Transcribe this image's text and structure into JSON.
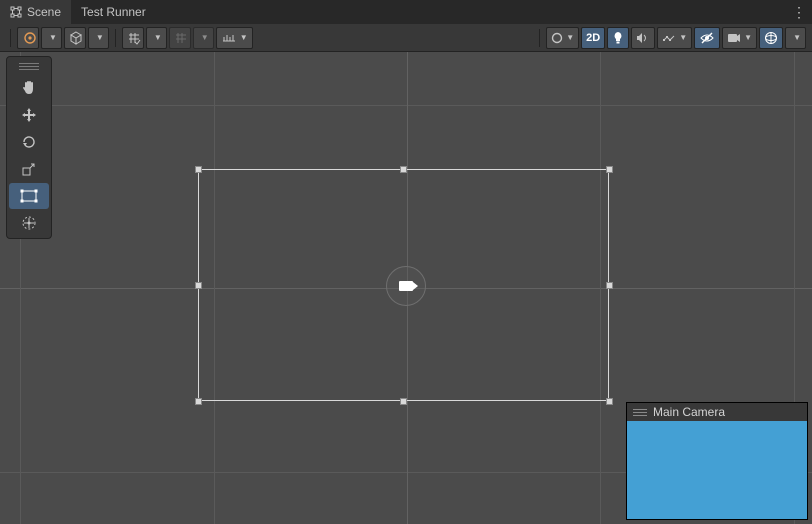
{
  "tabs": {
    "scene": "Scene",
    "test_runner": "Test Runner",
    "active": 0
  },
  "toolbar": {
    "two_d": "2D"
  },
  "tool_rail": {
    "tools": [
      "hand",
      "move",
      "rotate",
      "scale",
      "rect",
      "transform"
    ],
    "active": "rect"
  },
  "selection": {
    "object": "rect"
  },
  "camera_preview": {
    "title": "Main Camera",
    "sky_color": "#44a0d4"
  }
}
